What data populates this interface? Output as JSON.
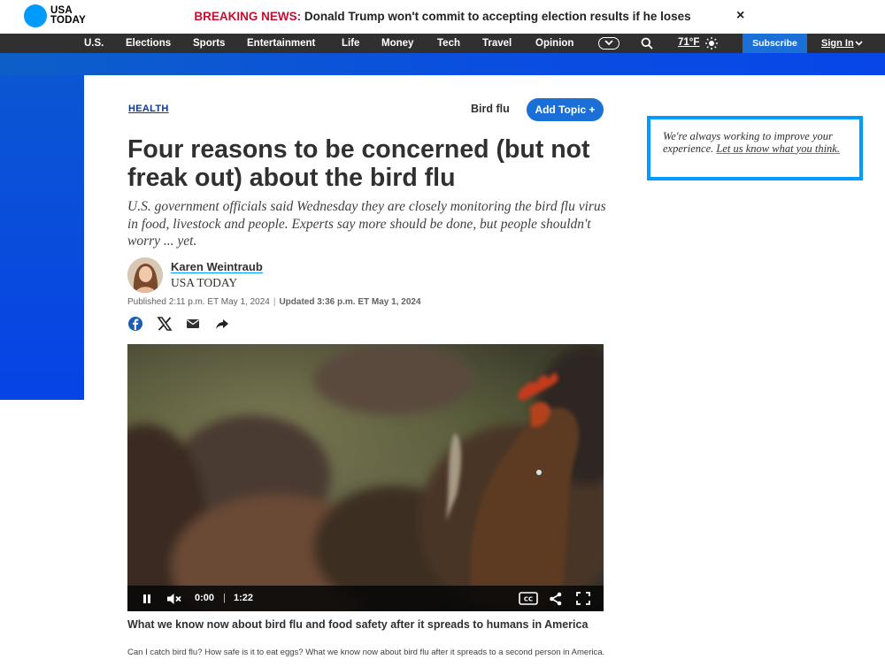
{
  "brand": {
    "logo_line1": "USA",
    "logo_line2": "TODAY"
  },
  "breaking": {
    "label": "BREAKING NEWS:",
    "text": "Donald Trump won't commit to accepting election results if he loses",
    "close": "×"
  },
  "nav": {
    "items": [
      "U.S.",
      "Elections",
      "Sports",
      "Entertainment",
      "Life",
      "Money",
      "Tech",
      "Travel",
      "Opinion"
    ],
    "temperature": "71°F",
    "subscribe": "Subscribe",
    "sign_in": "Sign In"
  },
  "article": {
    "section_tag": "HEALTH",
    "topic": "Bird flu",
    "add_topic": "Add Topic +",
    "headline": "Four reasons to be concerned (but not freak out) about the bird flu",
    "dek": "U.S. government officials said Wednesday they are closely monitoring the bird flu virus in food, livestock and people. Experts say more should be done, but people shouldn't worry ... yet.",
    "author": "Karen Weintraub",
    "org": "USA TODAY",
    "published": "Published 2:11 p.m. ET May 1, 2024",
    "separator": "|",
    "updated": "Updated 3:36 p.m. ET May 1, 2024",
    "share_icons": [
      "facebook-icon",
      "x-icon",
      "email-icon",
      "share-arrow-icon"
    ]
  },
  "video": {
    "current_time": "0:00",
    "separator": "|",
    "duration": "1:22",
    "progress": 0,
    "caption_title": "What we know now about bird flu and food safety after it spreads to humans in America",
    "caption_text": "Can I catch bird flu? How safe is it to eat eggs? What we know now about bird flu after it spreads to a second person in America."
  },
  "feedback": {
    "text": "We're always working to improve your experience.",
    "link": "Let us know what you think."
  },
  "colors": {
    "brand_blue": "#009bff",
    "breaking_red": "#c3102f",
    "nav_bg": "#303030",
    "accent_blue": "#1a70d6",
    "band_blue": "#0a4ee0"
  }
}
